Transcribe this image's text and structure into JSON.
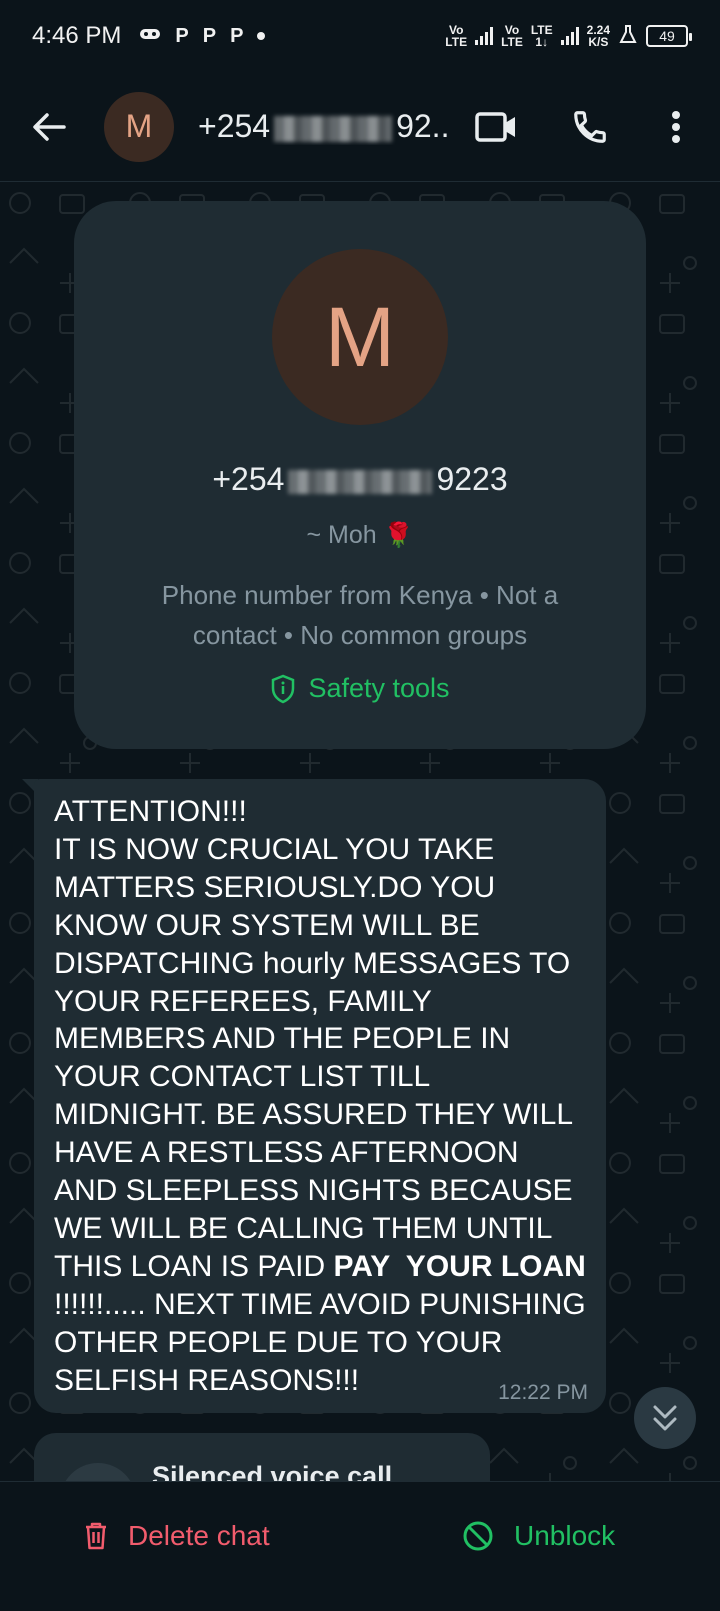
{
  "status_bar": {
    "time": "4:46 PM",
    "notifications": [
      "P",
      "P",
      "P"
    ],
    "net1": "Vo\nLTE",
    "net2": "Vo\nLTE",
    "net3": "LTE\n1↓",
    "speed": "2.24\nK/S",
    "battery": "49"
  },
  "header": {
    "avatar_letter": "M",
    "title_prefix": "+254",
    "title_suffix": "92..."
  },
  "info_card": {
    "avatar_letter": "M",
    "number_prefix": "+254",
    "number_suffix": "9223",
    "name": "~ Moh",
    "name_emoji": "🌹",
    "description": "Phone number from Kenya • Not a contact • No common groups",
    "safety_label": "Safety tools"
  },
  "message": {
    "text_before": "ATTENTION!!!\nIT IS NOW CRUCIAL YOU TAKE MATTERS SERIOUSLY.DO YOU KNOW OUR SYSTEM WILL BE DISPATCHING hourly MESSAGES TO YOUR REFEREES, FAMILY MEMBERS AND THE PEOPLE IN YOUR CONTACT LIST TILL MIDNIGHT. BE ASSURED THEY WILL HAVE A RESTLESS AFTERNOON AND SLEEPLESS NIGHTS BECAUSE WE WILL BE CALLING THEM UNTIL THIS LOAN IS PAID ",
    "text_bold": "PAY  YOUR LOAN",
    "text_after": "  !!!!!!..... NEXT TIME AVOID PUNISHING OTHER PEOPLE DUE TO YOUR SELFISH REASONS!!!",
    "time": "12:22 PM"
  },
  "call_bubble": {
    "label": "Silenced voice call"
  },
  "bottom_bar": {
    "delete_label": "Delete chat",
    "unblock_label": "Unblock"
  },
  "colors": {
    "accent_green": "#21c063",
    "danger_red": "#f15c6d",
    "bubble": "#1f2c33",
    "background": "#0b141a"
  },
  "icons": [
    "arrow-back-icon",
    "video-call-icon",
    "phone-icon",
    "more-vert-icon",
    "shield-icon",
    "chevrons-down-icon",
    "trash-icon",
    "block-icon"
  ]
}
